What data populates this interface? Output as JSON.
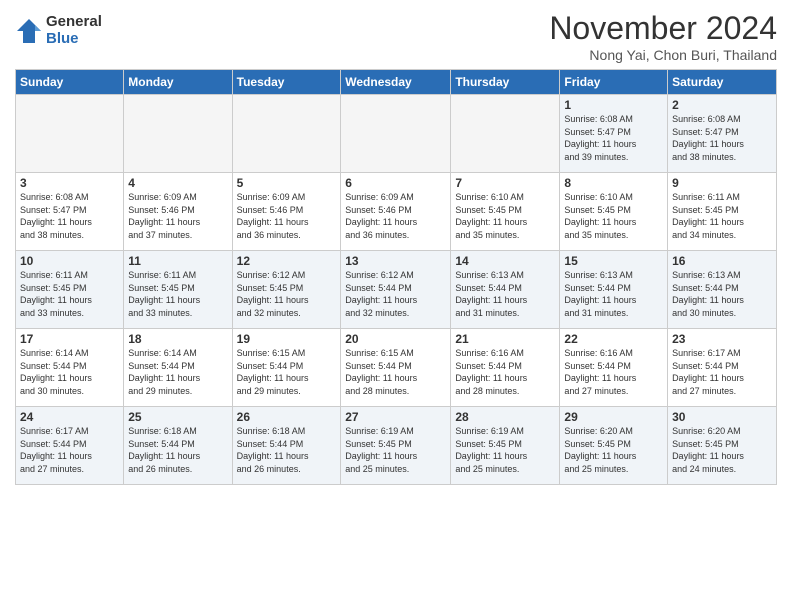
{
  "logo": {
    "general": "General",
    "blue": "Blue"
  },
  "title": "November 2024",
  "location": "Nong Yai, Chon Buri, Thailand",
  "days_header": [
    "Sunday",
    "Monday",
    "Tuesday",
    "Wednesday",
    "Thursday",
    "Friday",
    "Saturday"
  ],
  "weeks": [
    [
      {
        "day": "",
        "info": ""
      },
      {
        "day": "",
        "info": ""
      },
      {
        "day": "",
        "info": ""
      },
      {
        "day": "",
        "info": ""
      },
      {
        "day": "",
        "info": ""
      },
      {
        "day": "1",
        "info": "Sunrise: 6:08 AM\nSunset: 5:47 PM\nDaylight: 11 hours\nand 39 minutes."
      },
      {
        "day": "2",
        "info": "Sunrise: 6:08 AM\nSunset: 5:47 PM\nDaylight: 11 hours\nand 38 minutes."
      }
    ],
    [
      {
        "day": "3",
        "info": "Sunrise: 6:08 AM\nSunset: 5:47 PM\nDaylight: 11 hours\nand 38 minutes."
      },
      {
        "day": "4",
        "info": "Sunrise: 6:09 AM\nSunset: 5:46 PM\nDaylight: 11 hours\nand 37 minutes."
      },
      {
        "day": "5",
        "info": "Sunrise: 6:09 AM\nSunset: 5:46 PM\nDaylight: 11 hours\nand 36 minutes."
      },
      {
        "day": "6",
        "info": "Sunrise: 6:09 AM\nSunset: 5:46 PM\nDaylight: 11 hours\nand 36 minutes."
      },
      {
        "day": "7",
        "info": "Sunrise: 6:10 AM\nSunset: 5:45 PM\nDaylight: 11 hours\nand 35 minutes."
      },
      {
        "day": "8",
        "info": "Sunrise: 6:10 AM\nSunset: 5:45 PM\nDaylight: 11 hours\nand 35 minutes."
      },
      {
        "day": "9",
        "info": "Sunrise: 6:11 AM\nSunset: 5:45 PM\nDaylight: 11 hours\nand 34 minutes."
      }
    ],
    [
      {
        "day": "10",
        "info": "Sunrise: 6:11 AM\nSunset: 5:45 PM\nDaylight: 11 hours\nand 33 minutes."
      },
      {
        "day": "11",
        "info": "Sunrise: 6:11 AM\nSunset: 5:45 PM\nDaylight: 11 hours\nand 33 minutes."
      },
      {
        "day": "12",
        "info": "Sunrise: 6:12 AM\nSunset: 5:45 PM\nDaylight: 11 hours\nand 32 minutes."
      },
      {
        "day": "13",
        "info": "Sunrise: 6:12 AM\nSunset: 5:44 PM\nDaylight: 11 hours\nand 32 minutes."
      },
      {
        "day": "14",
        "info": "Sunrise: 6:13 AM\nSunset: 5:44 PM\nDaylight: 11 hours\nand 31 minutes."
      },
      {
        "day": "15",
        "info": "Sunrise: 6:13 AM\nSunset: 5:44 PM\nDaylight: 11 hours\nand 31 minutes."
      },
      {
        "day": "16",
        "info": "Sunrise: 6:13 AM\nSunset: 5:44 PM\nDaylight: 11 hours\nand 30 minutes."
      }
    ],
    [
      {
        "day": "17",
        "info": "Sunrise: 6:14 AM\nSunset: 5:44 PM\nDaylight: 11 hours\nand 30 minutes."
      },
      {
        "day": "18",
        "info": "Sunrise: 6:14 AM\nSunset: 5:44 PM\nDaylight: 11 hours\nand 29 minutes."
      },
      {
        "day": "19",
        "info": "Sunrise: 6:15 AM\nSunset: 5:44 PM\nDaylight: 11 hours\nand 29 minutes."
      },
      {
        "day": "20",
        "info": "Sunrise: 6:15 AM\nSunset: 5:44 PM\nDaylight: 11 hours\nand 28 minutes."
      },
      {
        "day": "21",
        "info": "Sunrise: 6:16 AM\nSunset: 5:44 PM\nDaylight: 11 hours\nand 28 minutes."
      },
      {
        "day": "22",
        "info": "Sunrise: 6:16 AM\nSunset: 5:44 PM\nDaylight: 11 hours\nand 27 minutes."
      },
      {
        "day": "23",
        "info": "Sunrise: 6:17 AM\nSunset: 5:44 PM\nDaylight: 11 hours\nand 27 minutes."
      }
    ],
    [
      {
        "day": "24",
        "info": "Sunrise: 6:17 AM\nSunset: 5:44 PM\nDaylight: 11 hours\nand 27 minutes."
      },
      {
        "day": "25",
        "info": "Sunrise: 6:18 AM\nSunset: 5:44 PM\nDaylight: 11 hours\nand 26 minutes."
      },
      {
        "day": "26",
        "info": "Sunrise: 6:18 AM\nSunset: 5:44 PM\nDaylight: 11 hours\nand 26 minutes."
      },
      {
        "day": "27",
        "info": "Sunrise: 6:19 AM\nSunset: 5:45 PM\nDaylight: 11 hours\nand 25 minutes."
      },
      {
        "day": "28",
        "info": "Sunrise: 6:19 AM\nSunset: 5:45 PM\nDaylight: 11 hours\nand 25 minutes."
      },
      {
        "day": "29",
        "info": "Sunrise: 6:20 AM\nSunset: 5:45 PM\nDaylight: 11 hours\nand 25 minutes."
      },
      {
        "day": "30",
        "info": "Sunrise: 6:20 AM\nSunset: 5:45 PM\nDaylight: 11 hours\nand 24 minutes."
      }
    ]
  ]
}
